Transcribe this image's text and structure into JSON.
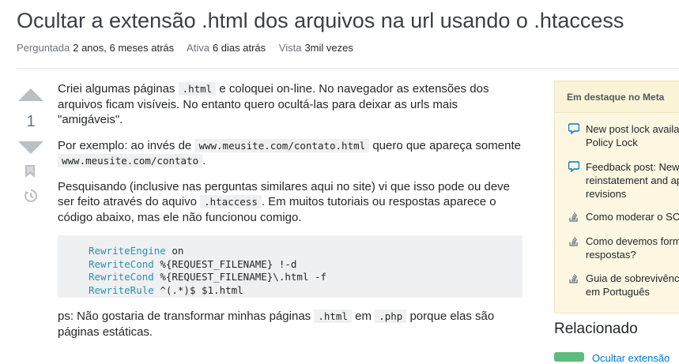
{
  "question": {
    "title": "Ocultar a extensão .html dos arquivos na url usando o .htaccess",
    "asked_label": "Perguntada",
    "asked_value": "2 anos, 6 meses atrás",
    "active_label": "Ativa",
    "active_value": "6 dias atrás",
    "viewed_label": "Vista",
    "viewed_value": "3mil vezes"
  },
  "vote": {
    "score": "1"
  },
  "body": {
    "p1_a": "Criei algumas páginas ",
    "p1_code": ".html",
    "p1_b": " e coloquei on-line. No navegador as extensões dos arquivos ficam visíveis. No entanto quero ocultá-las para deixar as urls mais \"amigáveis\".",
    "p2_a": "Por exemplo: ao invés de ",
    "p2_code1": "www.meusite.com/contato.html",
    "p2_b": " quero que apareça somente ",
    "p2_code2": "www.meusite.com/contato",
    "p2_c": ".",
    "p3_a": "Pesquisando (inclusive nas perguntas similares aqui no site) vi que isso pode ou deve ser feito através do aquivo ",
    "p3_code": ".htaccess",
    "p3_b": ". Em muitos tutoriais ou respostas aparece o código abaixo, mas ele não funcionou comigo.",
    "code_lines": [
      {
        "kw": "RewriteEngine",
        "rest": " on"
      },
      {
        "kw": "RewriteCond",
        "rest": " %{REQUEST_FILENAME} !-d"
      },
      {
        "kw": "RewriteCond",
        "rest": " %{REQUEST_FILENAME}\\.html -f"
      },
      {
        "kw": "RewriteRule",
        "rest": " ^(.*)$ $1.html"
      }
    ],
    "p4_a": "ps: Não gostaria de transformar minhas páginas ",
    "p4_code1": ".html",
    "p4_b": " em ",
    "p4_code2": ".php",
    "p4_c": " porque elas são páginas estáticas."
  },
  "sidebar": {
    "heading": "Em destaque no Meta",
    "items": [
      {
        "icon": "speech-bubble-icon",
        "line1": "New post lock availa",
        "line2": "Policy Lock"
      },
      {
        "icon": "speech-bubble-icon",
        "line1": "Feedback post: New",
        "line2": "reinstatement and ap",
        "line3": "revisions"
      },
      {
        "icon": "stack-logo-icon",
        "line1": "Como moderar o SO"
      },
      {
        "icon": "stack-logo-icon",
        "line1": "Como devemos form",
        "line2": "respostas?"
      },
      {
        "icon": "stack-logo-icon",
        "line1": "Guia de sobrevivênc",
        "line2": "em Português"
      }
    ]
  },
  "related": {
    "heading": "Relacionado",
    "first_link": "Ocultar extensão"
  },
  "colors": {
    "accent_blue": "#0077cc",
    "meta_bg": "#fdf7e2",
    "vote_gray": "#bbc0c4",
    "badge_green": "#5eba7d"
  }
}
